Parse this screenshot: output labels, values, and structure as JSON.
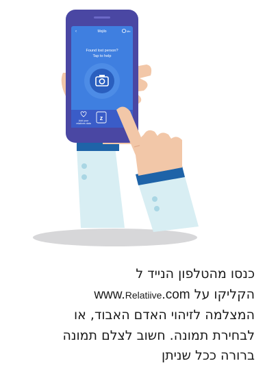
{
  "phone": {
    "app_title": "Mojilo",
    "top_right_label": "Me",
    "prompt_line1": "Found lost person?",
    "prompt_line2": "Tap to help",
    "bottom_left_label_line1": "Add your",
    "bottom_left_label_line2": "relatives data"
  },
  "caption": {
    "line1": "כנסו מהטלפון הנייד ל",
    "line2_before": "הקליקו על",
    "url_prefix": "www.",
    "url_middle": "Relatiive",
    "url_suffix": ".com",
    "line3": "המצלמה לזיהוי האדם האבוד, או",
    "line4": "לבחירת תמונה. חשוב לצלם תמונה",
    "line5": "ברורה ככל שניתן"
  },
  "colors": {
    "phone_body": "#4a47a3",
    "screen": "#3f7fe0",
    "skin": "#f2c7a8",
    "sleeve": "#d8eef3",
    "cuff": "#1e63a8",
    "shadow": "#d7d7d9"
  }
}
